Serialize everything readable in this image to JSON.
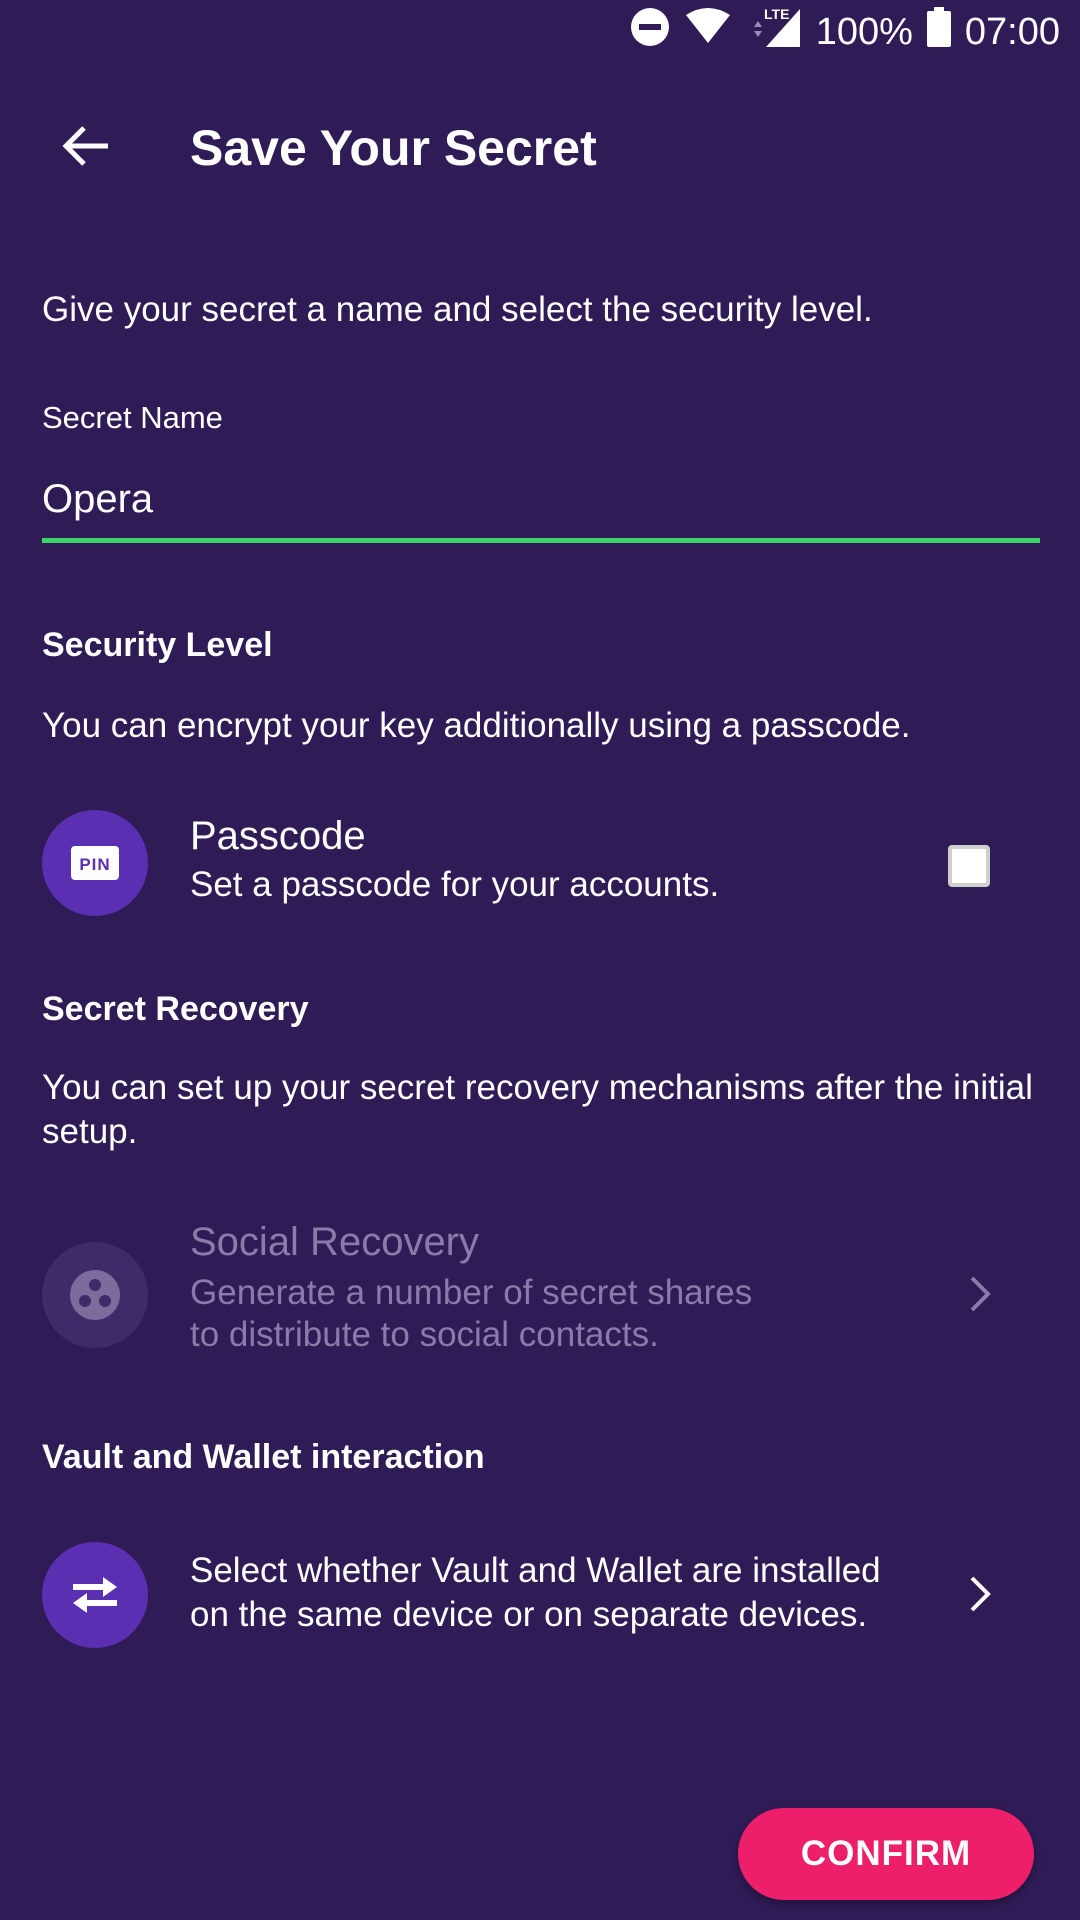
{
  "status_bar": {
    "battery_percent": "100%",
    "time": "07:00",
    "network": "LTE",
    "icons": [
      "do-not-disturb-icon",
      "wifi-icon",
      "signal-icon",
      "battery-icon"
    ]
  },
  "header": {
    "title": "Save Your Secret",
    "back_icon": "arrow-back-icon"
  },
  "intro": "Give your secret a name and select the security level.",
  "secret_name": {
    "label": "Secret Name",
    "value": "Opera",
    "underline_color": "#3dd46a"
  },
  "security": {
    "title": "Security Level",
    "description": "You can encrypt your key additionally using a passcode.",
    "passcode": {
      "icon": "pin-icon",
      "icon_text": "PIN",
      "title": "Passcode",
      "subtitle": "Set a passcode for your accounts.",
      "checked": false
    }
  },
  "recovery": {
    "title": "Secret Recovery",
    "description": "You can set up your secret recovery mechanisms after the initial setup.",
    "social": {
      "icon": "social-recovery-icon",
      "title": "Social Recovery",
      "subtitle_line1": "Generate a number of secret shares",
      "subtitle_line2": "to distribute to social contacts.",
      "enabled": false
    }
  },
  "interaction": {
    "title": "Vault and Wallet interaction",
    "icon": "swap-arrows-icon",
    "line1": "Select whether Vault and Wallet are installed",
    "line2": "on the same device or on separate devices."
  },
  "confirm_label": "CONFIRM",
  "colors": {
    "background": "#2f1b56",
    "accent": "#5a2fb1",
    "confirm": "#ee1f6a",
    "disabled_text": "#8c7aa8"
  }
}
